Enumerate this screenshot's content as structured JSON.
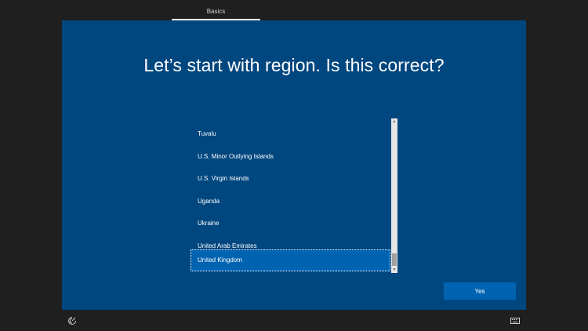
{
  "top_tabs": [
    {
      "label": "Basics",
      "active": true
    }
  ],
  "page": {
    "title": "Let’s start with region. Is this correct?"
  },
  "region_list": {
    "items": [
      {
        "label": "Tuvalu",
        "selected": false
      },
      {
        "label": "U.S. Minor Outlying Islands",
        "selected": false
      },
      {
        "label": "U.S. Virgin Islands",
        "selected": false
      },
      {
        "label": "Uganda",
        "selected": false
      },
      {
        "label": "Ukraine",
        "selected": false
      },
      {
        "label": "United Arab Emirates",
        "selected": false
      },
      {
        "label": "United Kingdom",
        "selected": true
      }
    ]
  },
  "buttons": {
    "yes_label": "Yes"
  },
  "icons": {
    "ease_of_access": "ease-of-access-icon",
    "keyboard": "keyboard-icon",
    "scroll_up": "chevron-up-icon",
    "scroll_down": "chevron-down-icon"
  },
  "colors": {
    "background": "#1f1f1f",
    "panel": "#00467f",
    "accent": "#0063b1",
    "text": "#ffffff"
  }
}
